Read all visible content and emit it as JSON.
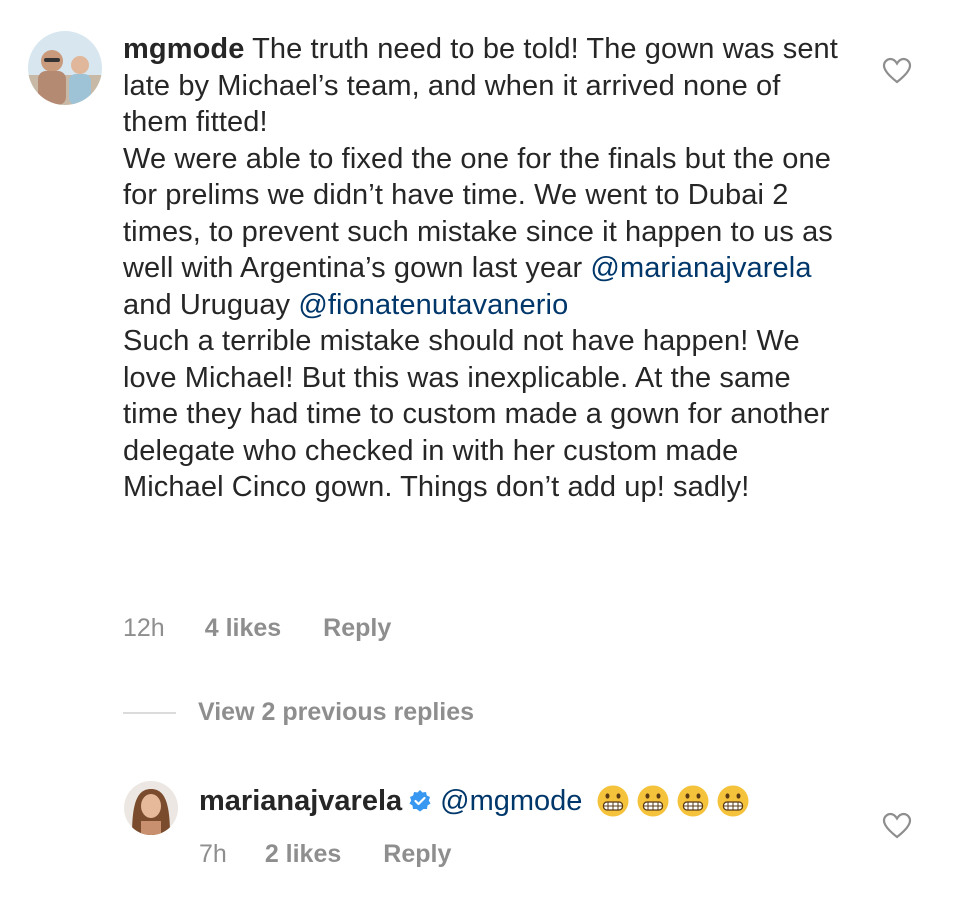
{
  "comment": {
    "username": "mgmode",
    "paragraphs": {
      "p1": "The truth need to be told! The gown was sent late by Michael’s team, and when it arrived none of them fitted!",
      "p2_before": "We were able to fixed the one for the finals but the one for prelims we didn’t have time. We went to Dubai 2 times, to prevent such mistake since it happen to us as well with Argentina’s gown last year ",
      "p2_mention1": "@marianajvarela",
      "p2_middle": " and Uruguay ",
      "p2_mention2": "@fionatenutavanerio",
      "p3": "Such a terrible mistake should not have happen! We love Michael! But this was inexplicable. At the same time they had time to custom made a gown for another delegate who checked in with her custom made Michael Cinco gown. Things don’t add up! sadly!"
    },
    "time": "12h",
    "likes": "4 likes",
    "reply_label": "Reply"
  },
  "view_replies": "View 2 previous replies",
  "reply": {
    "username": "marianajvarela",
    "mention": "@mgmode",
    "emojis": [
      "grimacing-face",
      "grimacing-face",
      "grimacing-face",
      "grimacing-face"
    ],
    "time": "7h",
    "likes": "2 likes",
    "reply_label": "Reply"
  },
  "colors": {
    "text": "#262626",
    "meta": "#8e8e8e",
    "mention": "#00376b",
    "verified": "#3897f0",
    "emoji": "#f5c33b"
  },
  "icons": [
    "heart-icon",
    "verified-badge-icon",
    "grimacing-face-emoji"
  ]
}
